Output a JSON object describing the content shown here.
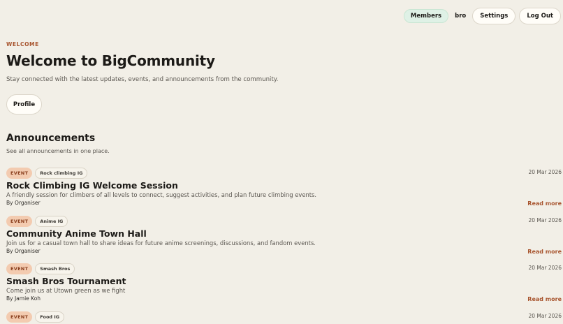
{
  "nav": {
    "members_label": "Members",
    "username": "bro",
    "settings_label": "Settings",
    "logout_label": "Log Out"
  },
  "hero": {
    "eyebrow": "WELCOME",
    "title": "Welcome to BigCommunity",
    "subtitle": "Stay connected with the latest updates, events, and announcements from the community.",
    "profile_label": "Profile"
  },
  "announcements": {
    "title": "Announcements",
    "subtitle": "See all announcements in one place.",
    "read_more_label": "Read more",
    "items": [
      {
        "type": "EVENT",
        "group": "Rock climbing IG",
        "date": "20 Mar 2026",
        "title": "Rock Climbing IG Welcome Session",
        "description": "A friendly session for climbers of all levels to connect, suggest activities, and plan future climbing events.",
        "author": "By Organiser"
      },
      {
        "type": "EVENT",
        "group": "Anime IG",
        "date": "20 Mar 2026",
        "title": "Community Anime Town Hall",
        "description": "Join us for a casual town hall to share ideas for future anime screenings, discussions, and fandom events.",
        "author": "By Organiser"
      },
      {
        "type": "EVENT",
        "group": "Smash Bros",
        "date": "20 Mar 2026",
        "title": "Smash Bros Tournament",
        "description": "Come join us at Utown green as we fight",
        "author": "By Jamie Koh"
      },
      {
        "type": "EVENT",
        "group": "Food IG",
        "date": "20 Mar 2026",
        "title": "",
        "description": "",
        "author": ""
      }
    ]
  }
}
